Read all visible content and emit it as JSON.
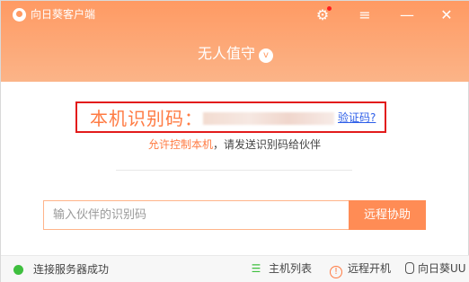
{
  "window": {
    "title": "向日葵客户端"
  },
  "header": {
    "status_label": "无人值守",
    "icons": [
      "settings-icon",
      "menu-icon",
      "minimize-icon",
      "close-icon"
    ]
  },
  "machine": {
    "id_label": "本机识别码：",
    "verify_link": "验证码?"
  },
  "hint": {
    "part1": "允许控制本机",
    "part2": "，请发送识别码给伙伴"
  },
  "assist": {
    "input_placeholder": "输入伙伴的识别码",
    "button_label": "远程协助"
  },
  "footer": {
    "connection_status": "连接服务器成功",
    "host_list": "主机列表",
    "remote_wake": "远程开机",
    "sunflower_uu": "向日葵UU"
  },
  "colors": {
    "accent": "#ff9a63",
    "button": "#ff8c55",
    "highlight_border": "#e21b1b",
    "link": "#2d5ee8",
    "online": "#3fbf3f"
  }
}
